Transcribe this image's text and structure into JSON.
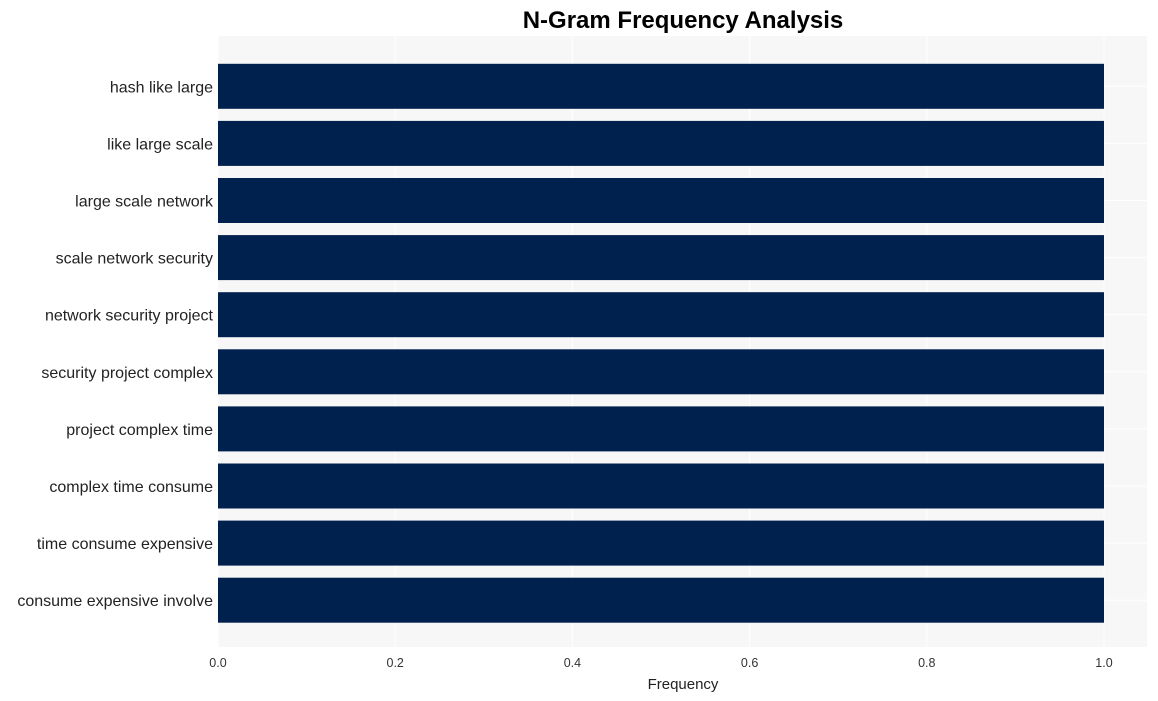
{
  "chart_data": {
    "type": "bar",
    "orientation": "horizontal",
    "title": "N-Gram Frequency Analysis",
    "xlabel": "Frequency",
    "ylabel": "",
    "categories": [
      "hash like large",
      "like large scale",
      "large scale network",
      "scale network security",
      "network security project",
      "security project complex",
      "project complex time",
      "complex time consume",
      "time consume expensive",
      "consume expensive involve"
    ],
    "values": [
      1,
      1,
      1,
      1,
      1,
      1,
      1,
      1,
      1,
      1
    ],
    "xlim": [
      0,
      1.05
    ],
    "xticks": [
      "0.0",
      "0.2",
      "0.4",
      "0.6",
      "0.8",
      "1.0"
    ],
    "grid": true,
    "legend": "none",
    "colors": {
      "bar": "#00204e",
      "plot_bg": "#f7f7f7",
      "grid": "#ffffff"
    }
  }
}
